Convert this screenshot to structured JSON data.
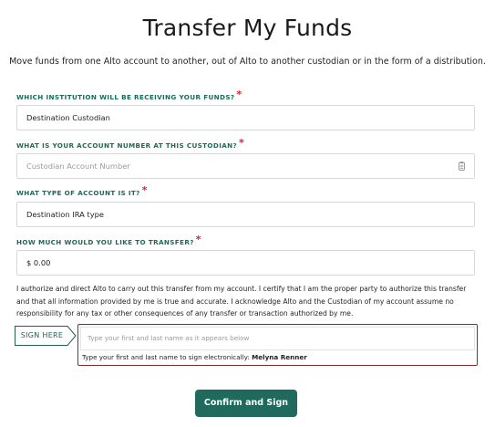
{
  "header": {
    "title": "Transfer My Funds",
    "subtitle": "Move funds from one Alto account to another, out of Alto to another custodian or in the form of a distribution."
  },
  "form": {
    "institution": {
      "label": "WHICH INSTITUTION WILL BE RECEIVING YOUR FUNDS?",
      "required_mark": "*",
      "value": "Destination Custodian"
    },
    "account_number": {
      "label": "WHAT IS YOUR ACCOUNT NUMBER AT THIS CUSTODIAN?",
      "required_mark": "*",
      "placeholder": "Custodian Account Number",
      "icon": "clipboard-icon"
    },
    "account_type": {
      "label": "WHAT TYPE OF ACCOUNT IS IT?",
      "required_mark": "*",
      "value": "Destination IRA type"
    },
    "amount": {
      "label": "HOW MUCH WOULD YOU LIKE TO TRANSFER?",
      "required_mark": "*",
      "value": "$ 0.00"
    }
  },
  "legal_text": "I authorize and direct Alto to carry out this transfer from my account. I certify that I am the proper party to authorize this transfer and that all information provided by me is true and accurate. I acknowledge Alto and the Custodian of my account assume no responsibility for any tax or other consequences of any transfer or transaction authorized by me.",
  "signature": {
    "tag_label": "SIGN HERE",
    "placeholder": "Type your first and last name as it appears below",
    "hint_prefix": "Type your first and last name to sign electronically:",
    "name": "Melyna Renner"
  },
  "actions": {
    "confirm_label": "Confirm and Sign"
  },
  "colors": {
    "accent": "#1f6a5c",
    "label": "#1b6a5a",
    "required": "#d0262c",
    "signature_border": "#8c2a2a"
  }
}
